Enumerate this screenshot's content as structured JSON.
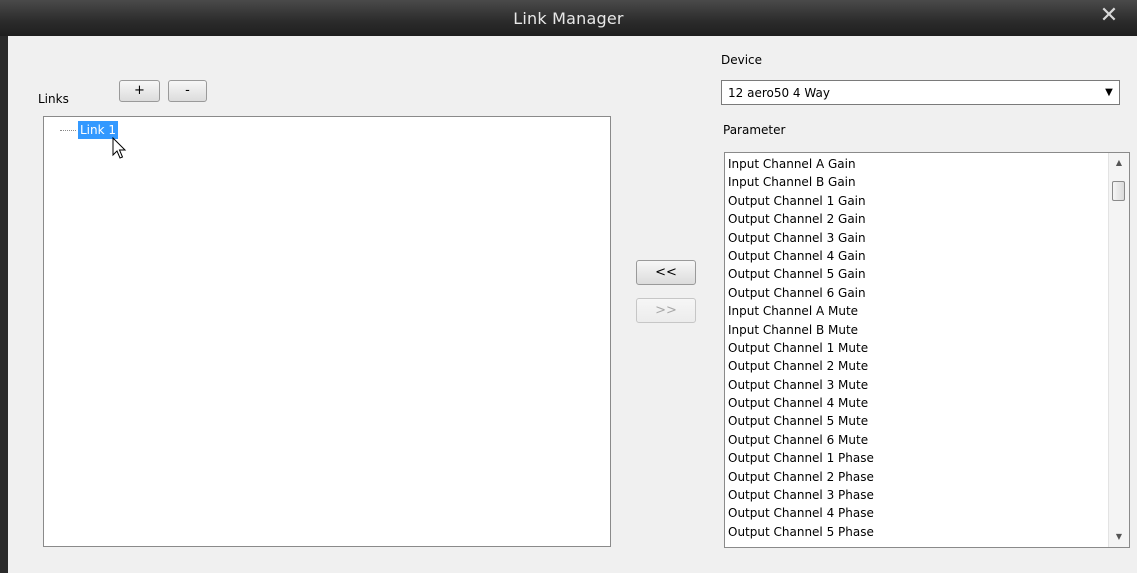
{
  "window": {
    "title": "Link Manager",
    "close_glyph": "✕"
  },
  "links": {
    "label": "Links",
    "add_label": "+",
    "remove_label": "-",
    "items": [
      {
        "label": "Link 1",
        "selected": true
      }
    ]
  },
  "transfer": {
    "left_label": "<<",
    "right_label": ">>"
  },
  "device": {
    "label": "Device",
    "selected": "12 aero50 4 Way"
  },
  "parameter": {
    "label": "Parameter",
    "items": [
      "Input Channel A Gain",
      "Input Channel B Gain",
      "Output Channel 1 Gain",
      "Output Channel 2 Gain",
      "Output Channel 3 Gain",
      "Output Channel 4 Gain",
      "Output Channel 5 Gain",
      "Output Channel 6 Gain",
      "Input Channel A Mute",
      "Input Channel B Mute",
      "Output Channel 1 Mute",
      "Output Channel 2 Mute",
      "Output Channel 3 Mute",
      "Output Channel 4 Mute",
      "Output Channel 5 Mute",
      "Output Channel 6 Mute",
      "Output Channel 1 Phase",
      "Output Channel 2 Phase",
      "Output Channel 3 Phase",
      "Output Channel 4 Phase",
      "Output Channel 5 Phase"
    ]
  }
}
